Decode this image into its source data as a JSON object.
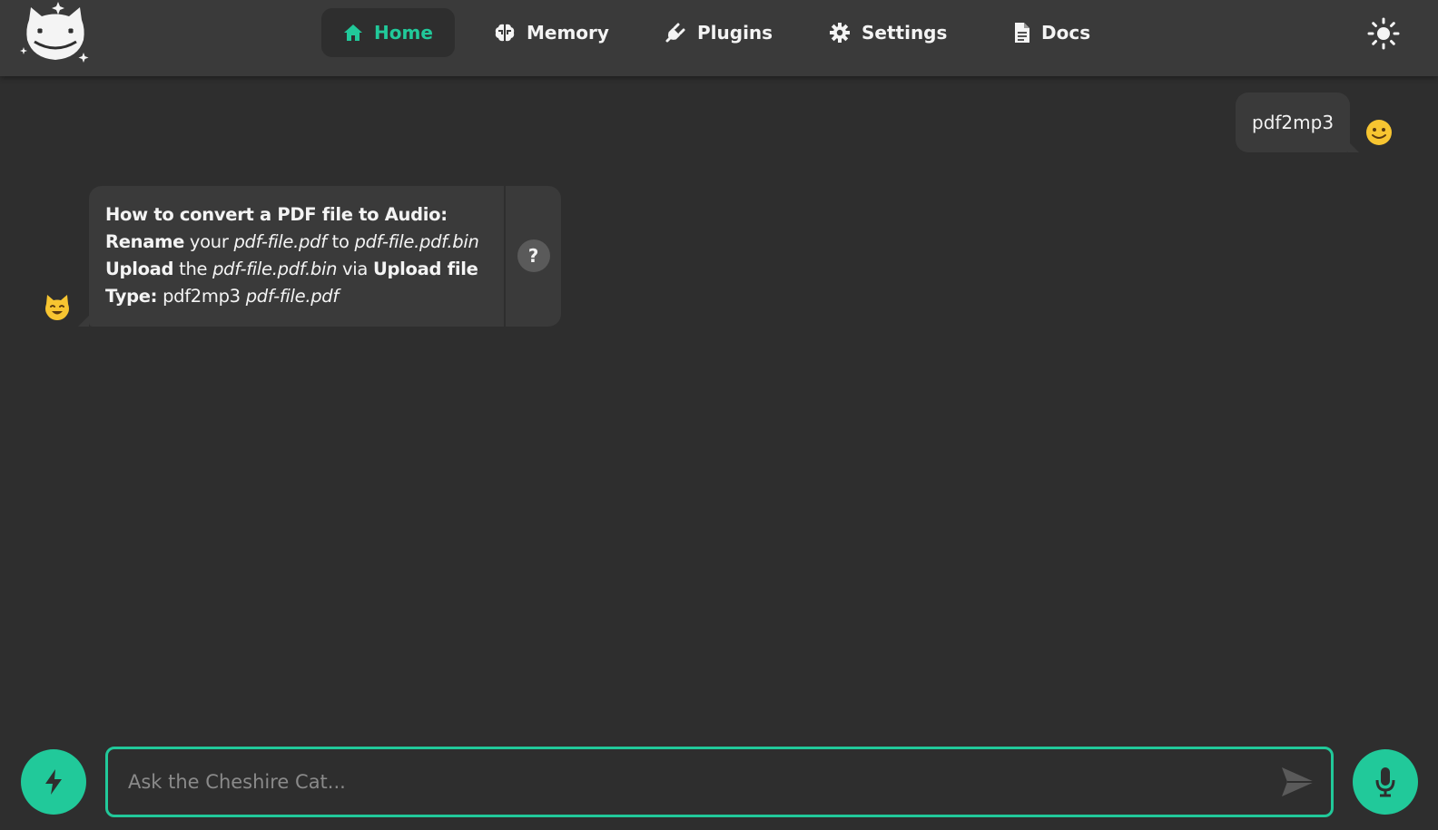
{
  "nav": {
    "items": [
      {
        "label": "Home",
        "icon": "home-icon",
        "active": true
      },
      {
        "label": "Memory",
        "icon": "brain-icon",
        "active": false
      },
      {
        "label": "Plugins",
        "icon": "plug-icon",
        "active": false
      },
      {
        "label": "Settings",
        "icon": "gear-icon",
        "active": false
      },
      {
        "label": "Docs",
        "icon": "document-icon",
        "active": false
      }
    ],
    "theme_toggle_icon": "sun-icon"
  },
  "messages": {
    "user": {
      "text": "pdf2mp3",
      "avatar": "🙂"
    },
    "bot": {
      "avatar": "😺",
      "line1_bold": "How to convert a PDF file to Audio:",
      "line2_bold": "Rename",
      "line2_text": " your ",
      "line2_italic1": "pdf-file.pdf",
      "line2_text2": " to ",
      "line2_italic2": "pdf-file.pdf.bin",
      "line3_bold": "Upload",
      "line3_text": " the ",
      "line3_italic": "pdf-file.pdf.bin",
      "line3_text2": " via ",
      "line3_bold2": "Upload file",
      "line4_bold": "Type:",
      "line4_text": " pdf2mp3 ",
      "line4_italic": "pdf-file.pdf",
      "why_label": "?"
    }
  },
  "input": {
    "placeholder": "Ask the Cheshire Cat...",
    "value": ""
  },
  "colors": {
    "accent": "#21c99a",
    "background": "#2e2e2e",
    "surface": "#3a3a3a"
  }
}
